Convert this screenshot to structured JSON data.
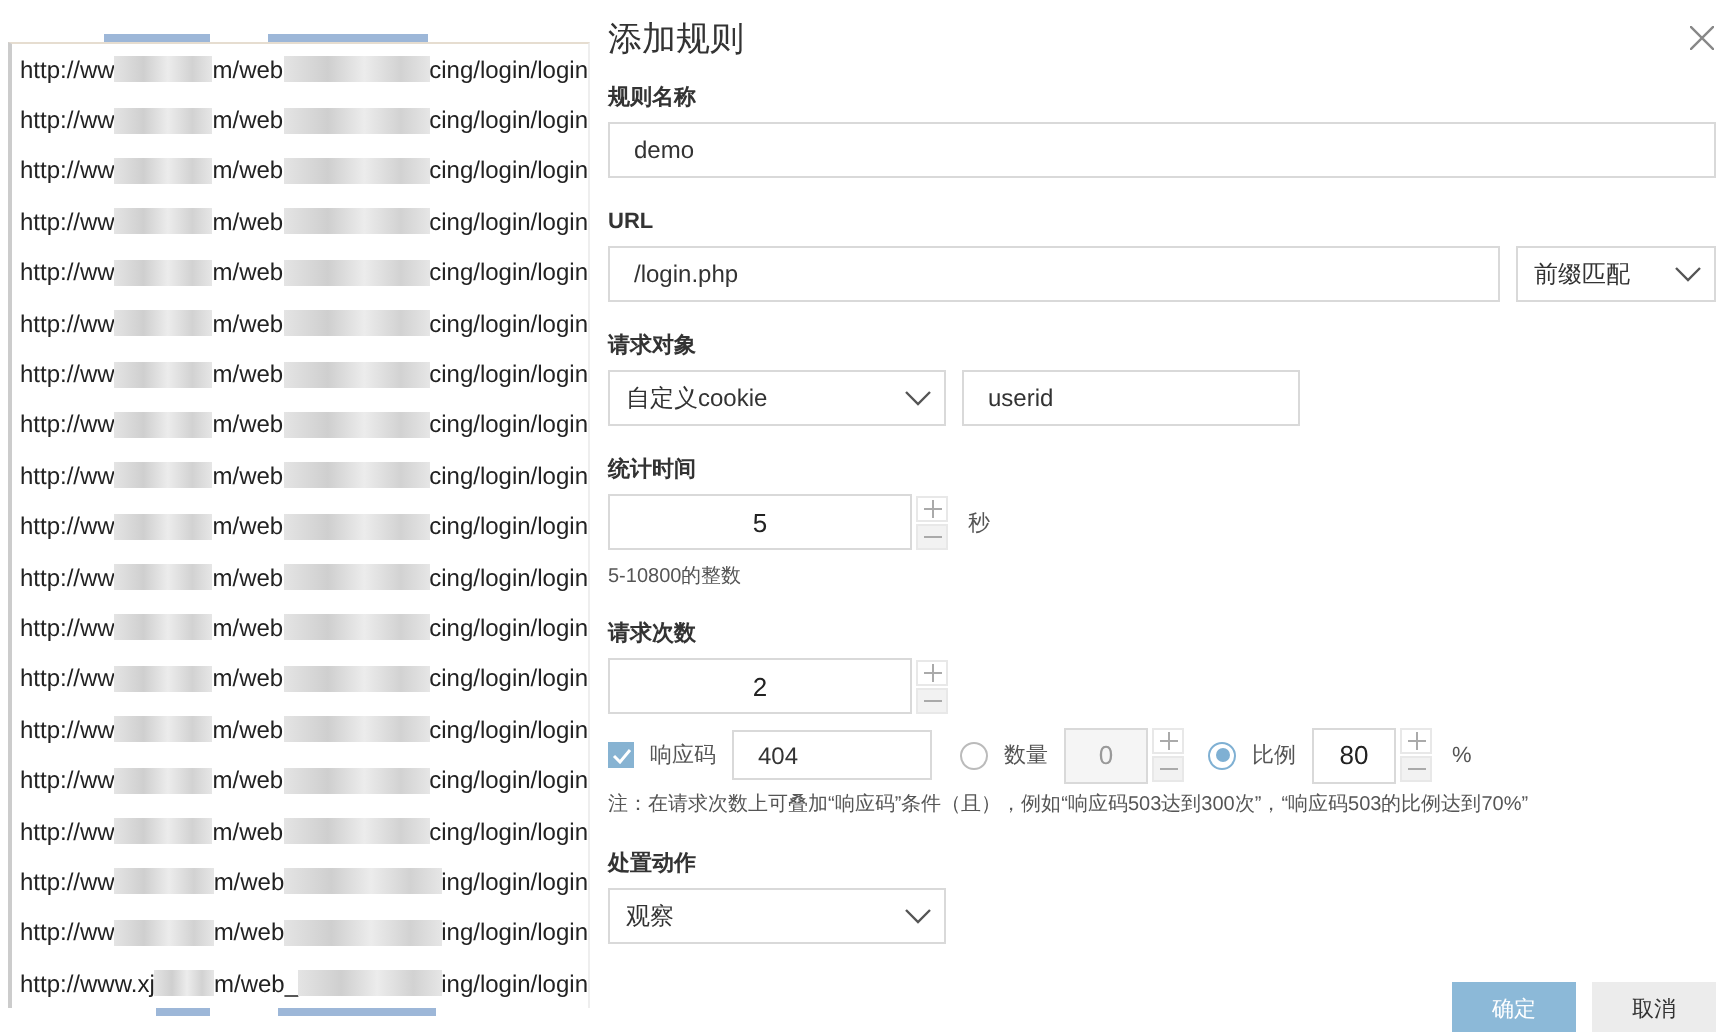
{
  "url_list": {
    "rows": [
      {
        "start": "http://ww",
        "middle": "m/web",
        "end": "cing/login/login"
      },
      {
        "start": "http://ww",
        "middle": "m/web",
        "end": "cing/login/login"
      },
      {
        "start": "http://ww",
        "middle": "m/web",
        "end": "cing/login/login"
      },
      {
        "start": "http://ww",
        "middle": "m/web",
        "end": "cing/login/login"
      },
      {
        "start": "http://ww",
        "middle": "m/web",
        "end": "cing/login/login"
      },
      {
        "start": "http://ww",
        "middle": "m/web",
        "end": "cing/login/login"
      },
      {
        "start": "http://ww",
        "middle": "m/web",
        "end": "cing/login/login"
      },
      {
        "start": "http://ww",
        "middle": "m/web",
        "end": "cing/login/login"
      },
      {
        "start": "http://ww",
        "middle": "m/web",
        "end": "cing/login/login"
      },
      {
        "start": "http://ww",
        "middle": "m/web",
        "end": "cing/login/login"
      },
      {
        "start": "http://ww",
        "middle": "m/web",
        "end": "cing/login/login"
      },
      {
        "start": "http://ww",
        "middle": "m/web",
        "end": "cing/login/login"
      },
      {
        "start": "http://ww",
        "middle": "m/web",
        "end": "cing/login/login"
      },
      {
        "start": "http://ww",
        "middle": "m/web",
        "end": "cing/login/login"
      },
      {
        "start": "http://ww",
        "middle": "m/web",
        "end": "cing/login/login"
      },
      {
        "start": "http://ww",
        "middle": "m/web",
        "end": "cing/login/login"
      },
      {
        "start": "http://ww",
        "middle": "m/web",
        "end": "ing/login/login"
      },
      {
        "start": "http://ww",
        "middle": "m/web",
        "end": "ing/login/login"
      },
      {
        "start": "http://www.xj",
        "middle": "m/web_",
        "end": "ing/login/login"
      }
    ]
  },
  "dialog": {
    "title": "添加规则",
    "name": {
      "label": "规则名称",
      "value": "demo"
    },
    "url": {
      "label": "URL",
      "value": "/login.php",
      "match": "前缀匹配"
    },
    "target": {
      "label": "请求对象",
      "type": "自定义cookie",
      "value": "userid"
    },
    "period": {
      "label": "统计时间",
      "value": "5",
      "unit": "秒",
      "hint": "5-10800的整数"
    },
    "count": {
      "label": "请求次数",
      "value": "2"
    },
    "status_code": {
      "checked": true,
      "label": "响应码",
      "value": "404"
    },
    "threshold_modes": [
      {
        "label": "数量",
        "selected": false,
        "value": "0",
        "disabled": true
      },
      {
        "label": "比例",
        "selected": true,
        "value": "80",
        "unit": "%",
        "disabled": false
      }
    ],
    "note": "注：在请求次数上可叠加“响应码”条件（且），例如“响应码503达到300次”，“响应码503的比例达到70%”",
    "action": {
      "label": "处置动作",
      "value": "观察"
    },
    "buttons": [
      {
        "label": "确定",
        "kind": "primary"
      },
      {
        "label": "取消",
        "kind": "default"
      }
    ]
  }
}
